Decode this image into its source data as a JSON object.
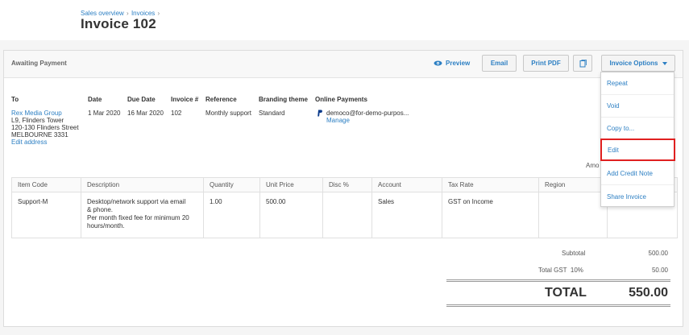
{
  "header": {
    "breadcrumb": [
      "Sales overview",
      "Invoices"
    ],
    "breadcrumb_sep": "›",
    "title": "Invoice 102"
  },
  "status": "Awaiting Payment",
  "toolbar": {
    "preview": "Preview",
    "email": "Email",
    "print_pdf": "Print PDF",
    "invoice_options": "Invoice Options",
    "copy_icon": "copy-icon",
    "dropdown_icon": "caret-down-icon"
  },
  "details": {
    "to_label": "To",
    "to_name": "Rex Media Group",
    "address": [
      "L9, Flinders Tower",
      "120-130 Flinders Street",
      "MELBOURNE 3331"
    ],
    "edit_address": "Edit address",
    "date_label": "Date",
    "date": "1 Mar 2020",
    "due_label": "Due Date",
    "due": "16 Mar 2020",
    "invoice_no_label": "Invoice #",
    "invoice_no": "102",
    "reference_label": "Reference",
    "reference": "Monthly support",
    "branding_label": "Branding theme",
    "branding": "Standard",
    "online_label": "Online Payments",
    "online_email": "democo@for-demo-purpos...",
    "online_manage": "Manage",
    "amounts_label": "Amo"
  },
  "table": {
    "headers": [
      "Item Code",
      "Description",
      "Quantity",
      "Unit Price",
      "Disc %",
      "Account",
      "Tax Rate",
      "Region",
      ""
    ],
    "row": {
      "item_code": "Support-M",
      "description": [
        "Desktop/network support via email",
        "& phone.",
        "Per month fixed fee for minimum 20",
        "hours/month."
      ],
      "quantity": "1.00",
      "unit_price": "500.00",
      "disc": "",
      "account": "Sales",
      "tax_rate": "GST on Income",
      "region": "",
      "amount": ""
    }
  },
  "totals": {
    "subtotal_label": "Subtotal",
    "subtotal": "500.00",
    "gst_label": "Total GST  10%",
    "gst": "50.00",
    "total_label": "TOTAL",
    "total": "550.00"
  },
  "menu": {
    "items": [
      "Repeat",
      "Void",
      "Copy to...",
      "Edit",
      "Add Credit Note",
      "Share Invoice"
    ],
    "highlighted_index": 3,
    "highlight_color": "#e02020"
  },
  "colors": {
    "link": "#2c7fc3",
    "status_bar": "#f8f8f8"
  }
}
